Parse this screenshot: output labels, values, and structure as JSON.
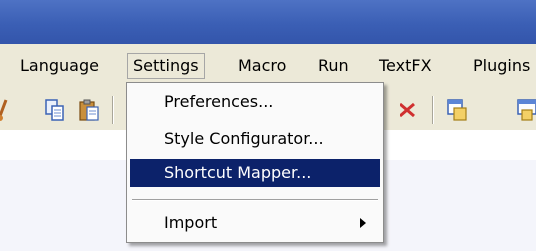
{
  "menubar": {
    "items": [
      {
        "label": "Language"
      },
      {
        "label": "Settings"
      },
      {
        "label": "Macro"
      },
      {
        "label": "Run"
      },
      {
        "label": "TextFX"
      },
      {
        "label": "Plugins"
      }
    ],
    "active": "Settings"
  },
  "settings_menu": {
    "items": [
      {
        "label": "Preferences..."
      },
      {
        "label": "Style Configurator..."
      },
      {
        "label": "Shortcut Mapper..."
      },
      {
        "label": "Import"
      }
    ],
    "selected": "Shortcut Mapper..."
  },
  "toolbar": {
    "icons": [
      "cut-icon",
      "copy-icon",
      "paste-icon",
      "close-icon",
      "sync-icon",
      "lock-icon"
    ]
  },
  "colors": {
    "titlebar": "#3b5fb5",
    "menubar": "#ece9d8",
    "highlight": "#0c226a"
  }
}
